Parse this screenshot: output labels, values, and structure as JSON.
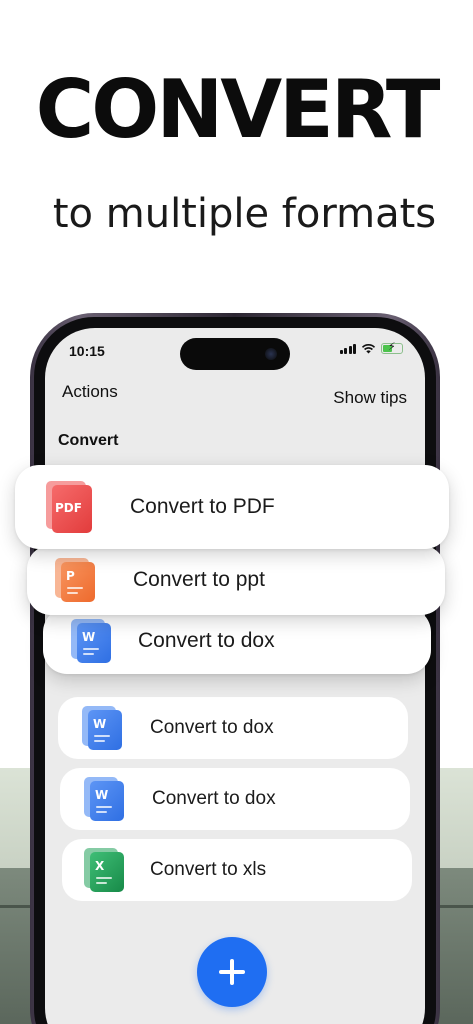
{
  "promo": {
    "headline": "CONVERT",
    "subheadline": "to multiple formats"
  },
  "status_bar": {
    "time": "10:15"
  },
  "header": {
    "actions_title": "Actions",
    "show_tips_label": "Show tips"
  },
  "section": {
    "title": "Convert"
  },
  "featured_cards": [
    {
      "label": "Convert to PDF",
      "icon": "pdf-file-icon",
      "icon_text": "PDF",
      "color": "#ef4b4b"
    },
    {
      "label": "Convert to ppt",
      "icon": "ppt-file-icon",
      "icon_text": "P",
      "color": "#f37a3e"
    },
    {
      "label": "Convert to dox",
      "icon": "word-file-icon",
      "icon_text": "W",
      "color": "#3d7ff0"
    }
  ],
  "list_items": [
    {
      "label": "Convert to dox",
      "icon": "word-file-icon",
      "icon_text": "W",
      "color": "#3d7ff0"
    },
    {
      "label": "Convert to dox",
      "icon": "word-file-icon",
      "icon_text": "W",
      "color": "#3d7ff0"
    },
    {
      "label": "Convert to xls",
      "icon": "excel-file-icon",
      "icon_text": "X",
      "color": "#20a15a"
    }
  ],
  "fab": {
    "icon": "plus-icon",
    "color": "#1f6ef2"
  }
}
